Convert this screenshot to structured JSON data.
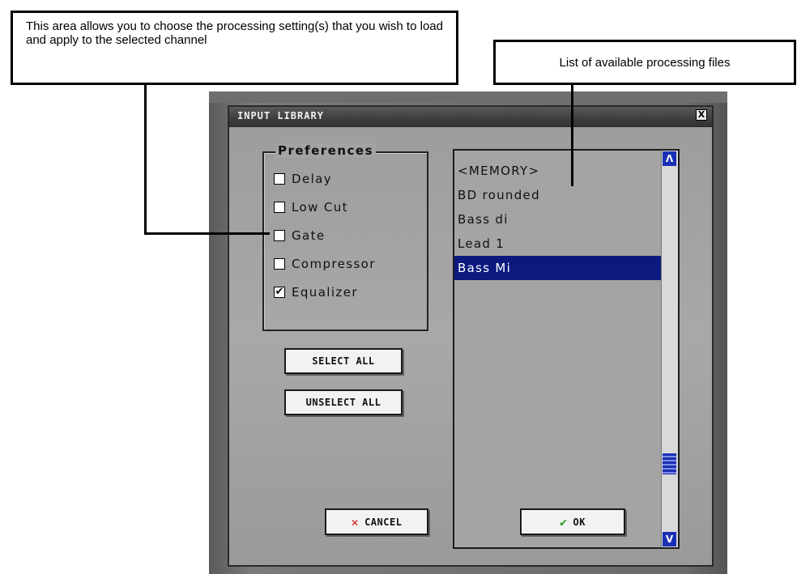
{
  "callouts": {
    "left_text": "This area allows you to choose the processing setting(s) that you wish to load and apply to the selected channel",
    "right_text": "List of available processing files"
  },
  "dialog": {
    "title": "INPUT LIBRARY",
    "close_label": "X",
    "preferences": {
      "legend": "Preferences",
      "items": [
        {
          "label": "Delay",
          "checked": false,
          "mark": ""
        },
        {
          "label": "Low Cut",
          "checked": false,
          "mark": ""
        },
        {
          "label": "Gate",
          "checked": false,
          "mark": ""
        },
        {
          "label": "Compressor",
          "checked": false,
          "mark": ""
        },
        {
          "label": "Equalizer",
          "checked": true,
          "mark": "✔"
        }
      ]
    },
    "select_all_label": "SELECT ALL",
    "unselect_all_label": "UNSELECT ALL",
    "list": {
      "items": [
        "<MEMORY>",
        "BD rounded",
        "Bass di",
        "Lead 1",
        "Bass Mi"
      ],
      "selected_index": 4,
      "scroll_up": "Λ",
      "scroll_down": "V"
    },
    "cancel_label": "CANCEL",
    "ok_label": "OK"
  },
  "colors": {
    "selection": "#0c1a80",
    "scroll": "#1a2fb5",
    "cancel_icon": "#d01818",
    "ok_icon": "#2ca02c"
  },
  "icons": {
    "cancel": "x-icon",
    "ok": "checkmark-icon"
  }
}
